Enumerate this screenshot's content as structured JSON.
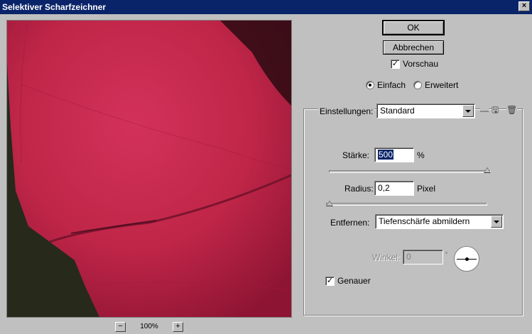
{
  "window": {
    "title": "Selektiver Scharfzeichner"
  },
  "buttons": {
    "ok": "OK",
    "cancel": "Abbrechen"
  },
  "preview_checkbox": {
    "label": "Vorschau",
    "checked": true
  },
  "mode": {
    "simple": "Einfach",
    "advanced": "Erweitert",
    "selected": "Einfach"
  },
  "settings": {
    "label": "Einstellungen:",
    "value": "Standard"
  },
  "amount": {
    "label": "Stärke:",
    "value": "500",
    "unit": "%",
    "slider_fraction": 1.0
  },
  "radius": {
    "label": "Radius:",
    "value": "0,2",
    "unit": "Pixel",
    "slider_fraction": 0.0
  },
  "remove": {
    "label": "Entfernen:",
    "value": "Tiefenschärfe abmildern"
  },
  "angle": {
    "label": "Winkel:",
    "value": "0",
    "unit": "°"
  },
  "more_accurate": {
    "label": "Genauer",
    "checked": true
  },
  "zoom": {
    "minus": "−",
    "plus": "+",
    "level": "100%"
  },
  "icons": {
    "close": "close-icon",
    "save_settings": "save-settings-icon",
    "delete_settings": "trash-icon"
  }
}
